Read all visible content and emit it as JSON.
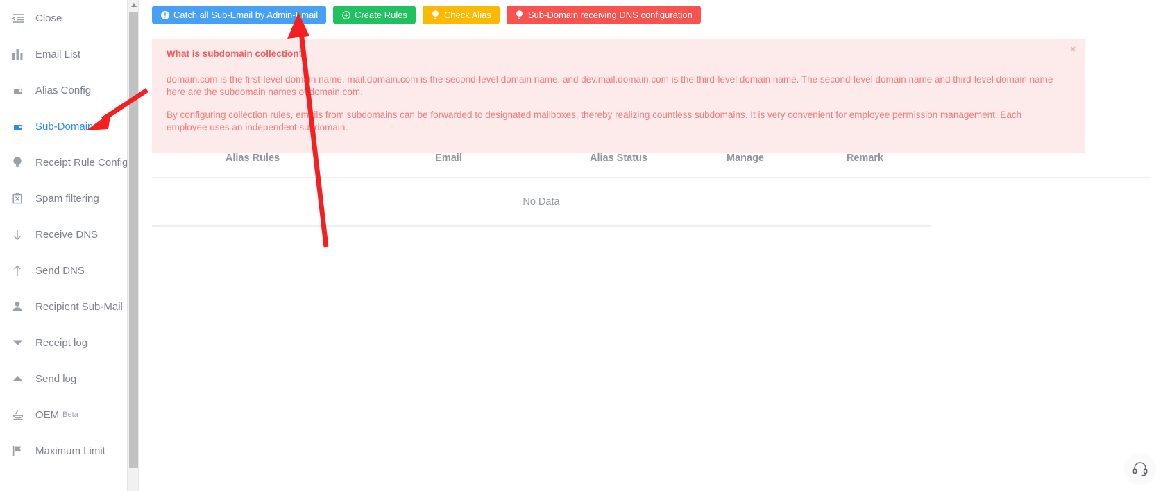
{
  "sidebar": {
    "items": [
      {
        "label": "Close",
        "icon": "list-collapse-icon",
        "active": false,
        "sup": ""
      },
      {
        "label": "Email List",
        "icon": "bar-chart-icon",
        "active": false,
        "sup": ""
      },
      {
        "label": "Alias Config",
        "icon": "mailbox-icon",
        "active": false,
        "sup": ""
      },
      {
        "label": "Sub-Domain",
        "icon": "mailbox-icon",
        "active": true,
        "sup": ""
      },
      {
        "label": "Receipt Rule Config",
        "icon": "lightbulb-icon",
        "active": false,
        "sup": ""
      },
      {
        "label": "Spam filtering",
        "icon": "spam-box-icon",
        "active": false,
        "sup": ""
      },
      {
        "label": "Receive DNS",
        "icon": "arrow-down-icon",
        "active": false,
        "sup": ""
      },
      {
        "label": "Send DNS",
        "icon": "arrow-up-icon",
        "active": false,
        "sup": ""
      },
      {
        "label": "Recipient Sub-Mail",
        "icon": "user-icon",
        "active": false,
        "sup": ""
      },
      {
        "label": "Receipt log",
        "icon": "caret-down-icon",
        "active": false,
        "sup": ""
      },
      {
        "label": "Send log",
        "icon": "caret-up-icon",
        "active": false,
        "sup": ""
      },
      {
        "label": "OEM",
        "icon": "stamp-icon",
        "active": false,
        "sup": "Beta"
      },
      {
        "label": "Maximum Limit",
        "icon": "flag-icon",
        "active": false,
        "sup": ""
      }
    ]
  },
  "toolbar": {
    "buttons": [
      {
        "label": "Catch all Sub-Email by Admin-Email",
        "color": "#46a0f5",
        "icon": "info-circle-icon"
      },
      {
        "label": "Create Rules",
        "color": "#20c15f",
        "icon": "plus-circle-icon"
      },
      {
        "label": "Check Alias",
        "color": "#fcb900",
        "icon": "bulb-icon"
      },
      {
        "label": "Sub-Domain receiving DNS configuration",
        "color": "#f9524f",
        "icon": "bulb-icon"
      }
    ]
  },
  "alert": {
    "title": "What is subdomain collection?",
    "paragraph_1": "domain.com is the first-level domain name, mail.domain.com is the second-level domain name, and dev.mail.domain.com is the third-level domain name. The second-level domain name and third-level domain name here are the subdomain names of domain.com.",
    "paragraph_2": "By configuring collection rules, emails from subdomains can be forwarded to designated mailboxes, thereby realizing countless subdomains. It is very convenient for employee permission management. Each employee uses an independent subdomain.",
    "close_label": "×",
    "background_color": "#fdeaea",
    "text_color": "#f37b7b"
  },
  "table": {
    "headers": [
      "Alias Rules",
      "Email",
      "Alias Status",
      "Manage",
      "Remark"
    ],
    "rows": [],
    "empty_text": "No Data"
  },
  "support": {
    "icon": "headset-icon"
  }
}
